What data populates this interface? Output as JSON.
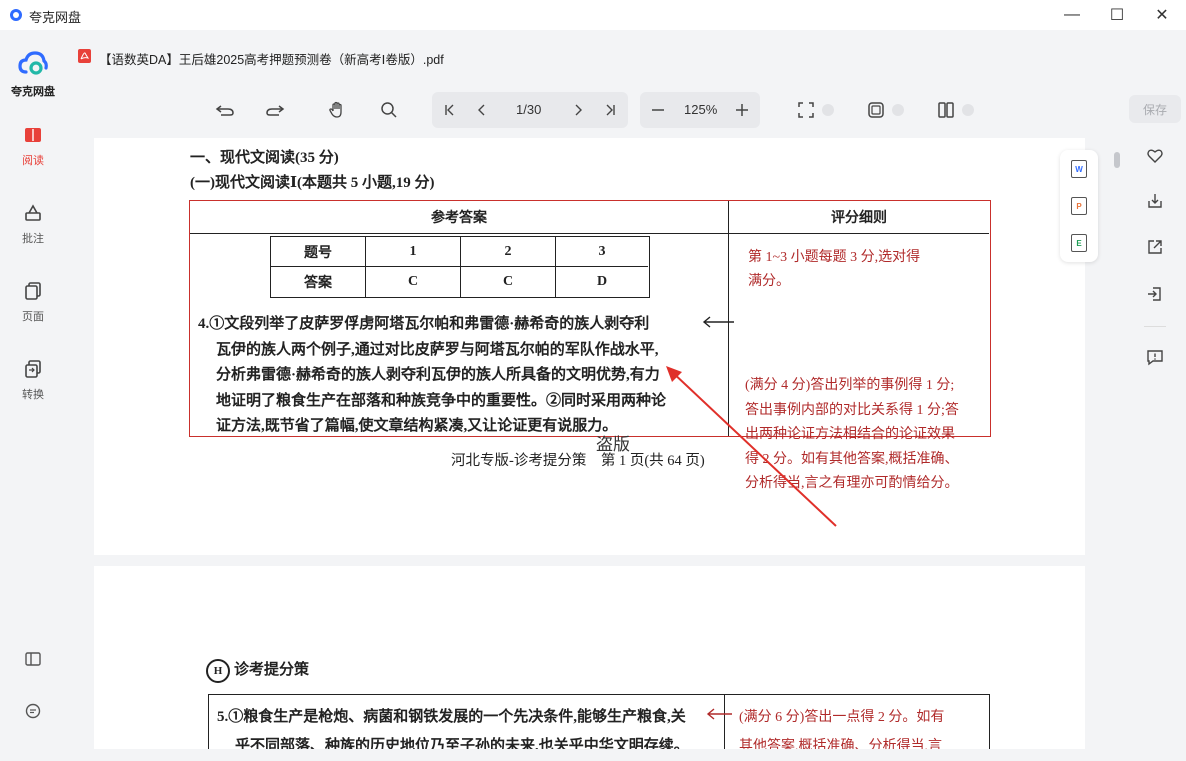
{
  "window": {
    "app_title": "夸克网盘",
    "minimize_glyph": "—",
    "maximize_glyph": "☐",
    "close_glyph": "✕"
  },
  "sidebar": {
    "brand_label": "夸克网盘",
    "items": [
      {
        "label": "阅读",
        "icon": "book-icon",
        "active": true
      },
      {
        "label": "批注",
        "icon": "annotate-icon",
        "active": false
      },
      {
        "label": "页面",
        "icon": "pages-icon",
        "active": false
      },
      {
        "label": "转换",
        "icon": "convert-icon",
        "active": false
      }
    ],
    "accent_color": "#e8413a"
  },
  "file": {
    "name": "【语数英DA】王后雄2025高考押题预测卷（新高考Ⅰ卷版）.pdf"
  },
  "toolbar": {
    "page_indicator": "1/30",
    "zoom_level": "125%",
    "save_label": "保存"
  },
  "page1": {
    "section_title": "一、现代文阅读(35 分)",
    "subsection_title": "(一)现代文阅读Ⅰ(本题共 5 小题,19 分)",
    "table_header_left": "参考答案",
    "table_header_right": "评分细则",
    "answer_table": {
      "row_labels": [
        "题号",
        "答案"
      ],
      "numbers": [
        "1",
        "2",
        "3"
      ],
      "answers": [
        "C",
        "C",
        "D"
      ]
    },
    "grading_1_lines": [
      "第 1~3 小题每题 3 分,选对得",
      "满分。"
    ],
    "q4_lines": [
      "4.①文段列举了皮萨罗俘虏阿塔瓦尔帕和弗雷德·赫希奇的族人剥夺利",
      "瓦伊的族人两个例子,通过对比皮萨罗与阿塔瓦尔帕的军队作战水平,",
      "分析弗雷德·赫希奇的族人剥夺利瓦伊的族人所具备的文明优势,有力",
      "地证明了粮食生产在部落和种族竞争中的重要性。②同时采用两种论",
      "证方法,既节省了篇幅,使文章结构紧凑,又让论证更有说服力。"
    ],
    "grading_4_lines": [
      "(满分 4 分)答出列举的事例得 1 分;",
      "答出事例内部的对比关系得 1 分;答",
      "出两种论证方法相结合的论证效果",
      "得 2 分。如有其他答案,概括准确、",
      "分析得当,言之有理亦可酌情给分。"
    ],
    "watermark": "盗版",
    "footer": "河北专版-诊考提分策　第 1 页(共 64 页)"
  },
  "page2": {
    "logo_text": "诊考提分策",
    "q5_lines": [
      "5.①粮食生产是枪炮、病菌和钢铁发展的一个先决条件,能够生产粮食,关",
      "乎不同部落、种族的历史地位乃至子孙的未来,也关乎中华文明存续。"
    ],
    "grading_5_lines": [
      "(满分 6 分)答出一点得 2 分。如有",
      "其他答案,概括准确、分析得当,言"
    ]
  },
  "float_tools": [
    "W",
    "P",
    "E"
  ],
  "colors": {
    "table_border_red": "#c9302c",
    "grading_text_red": "#b02a2a",
    "arrow_red": "#e0302a"
  }
}
